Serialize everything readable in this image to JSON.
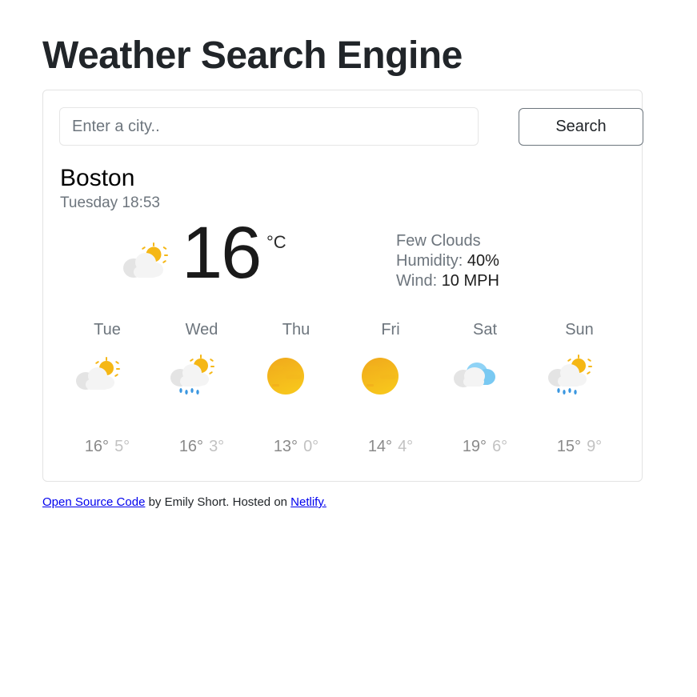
{
  "title": "Weather Search Engine",
  "search": {
    "placeholder": "Enter a city..",
    "value": "",
    "button_label": "Search"
  },
  "current": {
    "city": "Boston",
    "date_time": "Tuesday 18:53",
    "temperature": "16",
    "unit": "°C",
    "icon": "partly-cloudy-icon",
    "description": "Few Clouds",
    "humidity_label": "Humidity:",
    "humidity_value": "40%",
    "wind_label": "Wind:",
    "wind_value": "10 MPH"
  },
  "forecast": [
    {
      "day": "Tue",
      "icon": "partly-cloudy-icon",
      "high": "16°",
      "low": "5°"
    },
    {
      "day": "Wed",
      "icon": "partly-cloudy-rain-icon",
      "high": "16°",
      "low": "3°"
    },
    {
      "day": "Thu",
      "icon": "sun-icon",
      "high": "13°",
      "low": "0°"
    },
    {
      "day": "Fri",
      "icon": "sun-icon",
      "high": "14°",
      "low": "4°"
    },
    {
      "day": "Sat",
      "icon": "cloudy-icon",
      "high": "19°",
      "low": "6°"
    },
    {
      "day": "Sun",
      "icon": "partly-cloudy-rain-icon",
      "high": "15°",
      "low": "9°"
    }
  ],
  "footer": {
    "link1": "Open Source Code",
    "middle": " by Emily Short. Hosted on ",
    "link2": "Netlify."
  },
  "colors": {
    "sun": "#f5b715",
    "cloud": "#efefef",
    "blue_cloud": "#79c9f2",
    "rain": "#3b97e0",
    "link": "#0000ee"
  }
}
